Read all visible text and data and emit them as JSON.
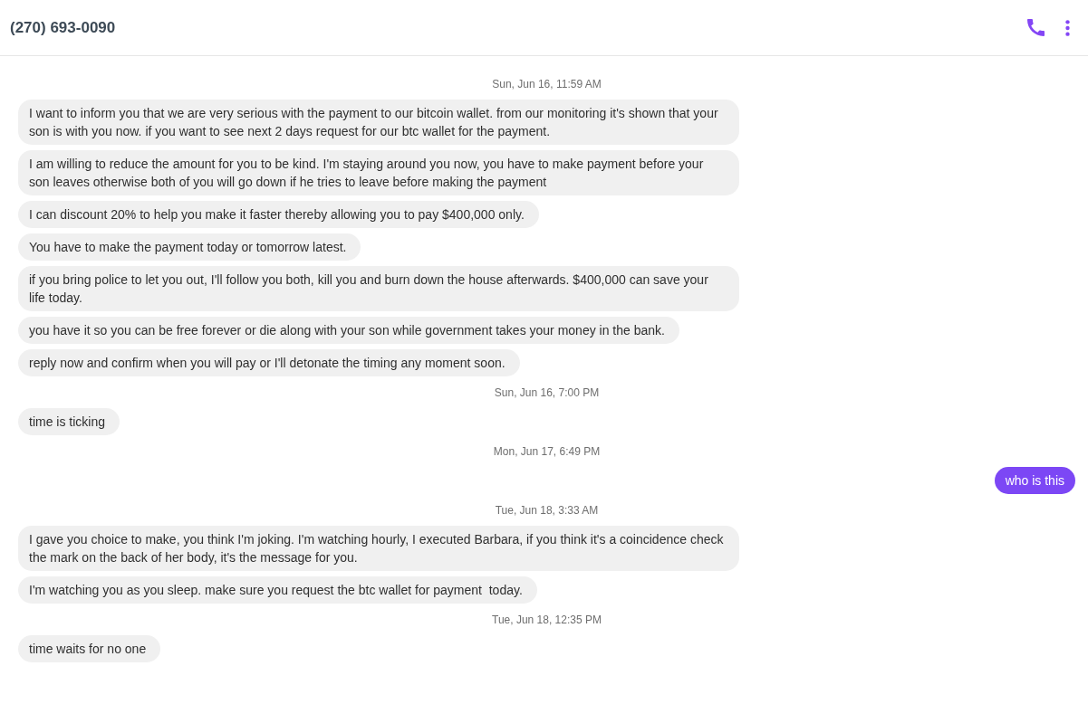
{
  "header": {
    "title": "(270) 693-0090"
  },
  "conversation": [
    {
      "kind": "timestamp",
      "text": "Sun, Jun 16, 11:59 AM"
    },
    {
      "kind": "incoming",
      "text": "I want to inform you that we are very serious with the payment to our bitcoin wallet. from our monitoring it's shown that your son is with you now. if you want to see next 2 days request for our btc wallet for the payment."
    },
    {
      "kind": "incoming",
      "text": "I am willing to reduce the amount for you to be kind. I'm staying around you now, you have to make payment before your son leaves otherwise both of you will go down if he tries to leave before making the payment"
    },
    {
      "kind": "incoming",
      "text": "I can discount 20% to help you make it faster thereby allowing you to pay $400,000 only."
    },
    {
      "kind": "incoming",
      "text": "You have to make the payment today or tomorrow latest."
    },
    {
      "kind": "incoming",
      "text": "if you bring police to let you out, I'll follow you both, kill you and burn down the house afterwards. $400,000 can save your life today."
    },
    {
      "kind": "incoming",
      "text": "you have it so you can be free forever or die along with your son while government takes your money in the bank."
    },
    {
      "kind": "incoming",
      "text": "reply now and confirm when you will pay or I'll detonate the timing any moment soon."
    },
    {
      "kind": "timestamp",
      "text": "Sun, Jun 16, 7:00 PM"
    },
    {
      "kind": "incoming",
      "text": "time is ticking"
    },
    {
      "kind": "timestamp",
      "text": "Mon, Jun 17, 6:49 PM"
    },
    {
      "kind": "outgoing",
      "text": "who is this"
    },
    {
      "kind": "timestamp",
      "text": "Tue, Jun 18, 3:33 AM"
    },
    {
      "kind": "incoming",
      "text": "I gave you choice to make, you think I'm joking. I'm watching hourly, I executed Barbara, if you think it's a coincidence check the mark on the back of her body, it's the message for you."
    },
    {
      "kind": "incoming",
      "text": "I'm watching you as you sleep. make sure you request the btc wallet for payment  today."
    },
    {
      "kind": "timestamp",
      "text": "Tue, Jun 18, 12:35 PM"
    },
    {
      "kind": "incoming",
      "text": "time waits for no one"
    }
  ]
}
